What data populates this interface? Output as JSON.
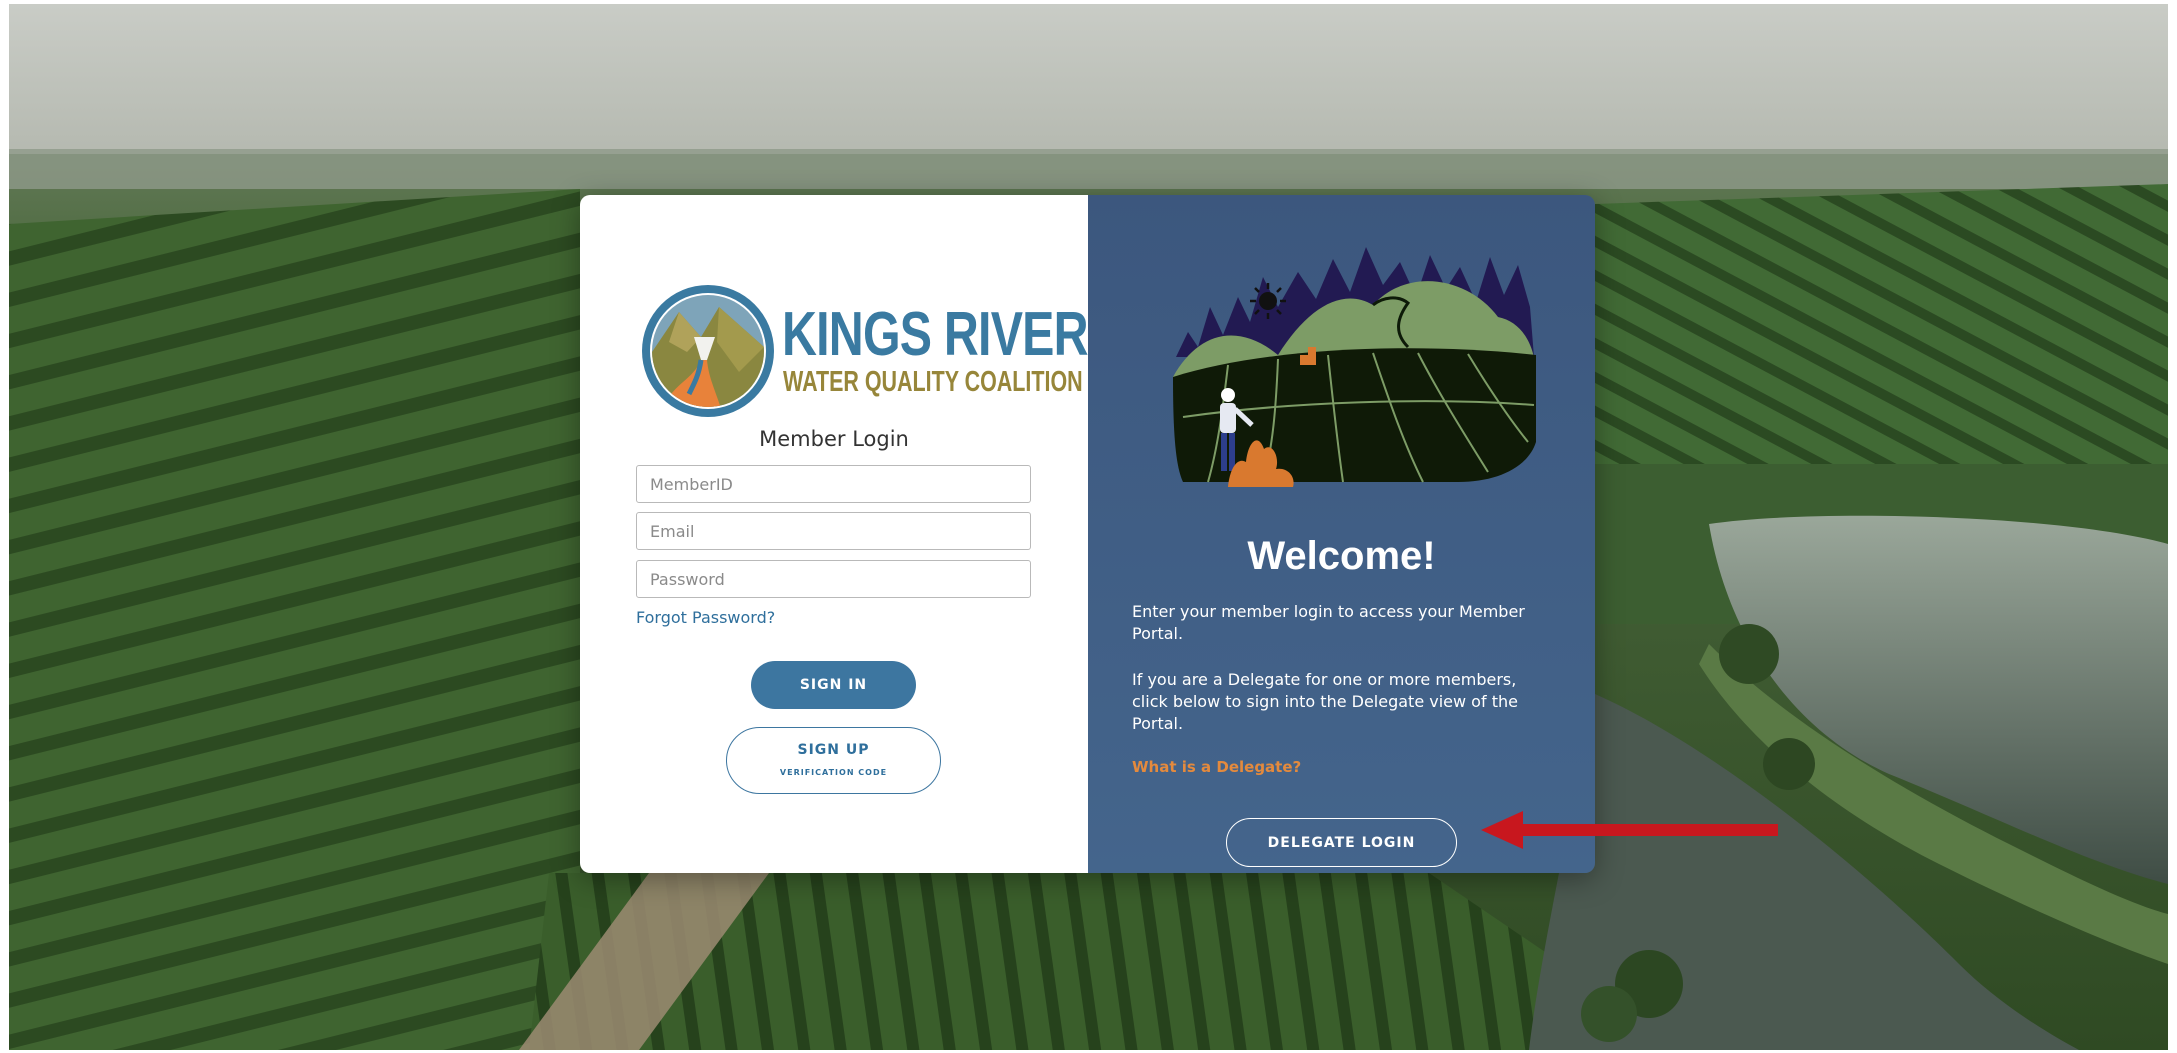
{
  "logo": {
    "line1": "KINGS RIVER",
    "line2": "WATER QUALITY COALITION"
  },
  "login": {
    "title": "Member Login",
    "memberid_placeholder": "MemberID",
    "email_placeholder": "Email",
    "password_placeholder": "Password",
    "forgot_password": "Forgot Password?",
    "sign_in": "SIGN IN",
    "sign_up": "SIGN UP",
    "sign_up_sub": "VERIFICATION CODE"
  },
  "welcome": {
    "title": "Welcome!",
    "text1": "Enter your member login to access your Member Portal.",
    "text2": "If you are a Delegate for one or more members, click below to sign into the Delegate view of the Portal.",
    "delegate_link": "What is a Delegate?",
    "delegate_button": "DELEGATE LOGIN"
  },
  "colors": {
    "brand_blue": "#3d76a0",
    "panel_blue": "#44658c",
    "accent_orange": "#e48a3d",
    "logo_gold": "#97863a",
    "annotation_red": "#c8171e"
  },
  "icons": {
    "emblem": "river-valley-emblem",
    "illustration": "farmer-field-illustration",
    "annotation": "red-arrow-left"
  }
}
